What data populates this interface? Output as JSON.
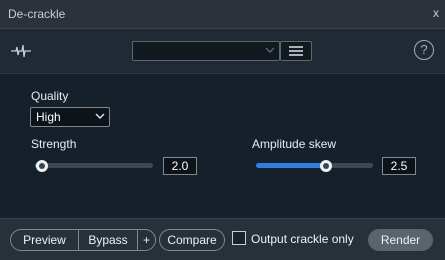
{
  "window": {
    "title": "De-crackle",
    "close": "x"
  },
  "toolbar": {
    "help": "?"
  },
  "quality": {
    "label": "Quality",
    "value": "High"
  },
  "strength": {
    "label": "Strength",
    "value": "2.0",
    "fraction": 0.06
  },
  "amplitude_skew": {
    "label": "Amplitude skew",
    "value": "2.5",
    "fraction": 0.6
  },
  "footer": {
    "preview": "Preview",
    "bypass": "Bypass",
    "plus": "+",
    "compare": "Compare",
    "output_crackle_only": "Output crackle only",
    "output_crackle_checked": false,
    "render": "Render"
  },
  "colors": {
    "accent": "#2f7fe0",
    "background": "#16202a",
    "footer": "#27313a"
  }
}
